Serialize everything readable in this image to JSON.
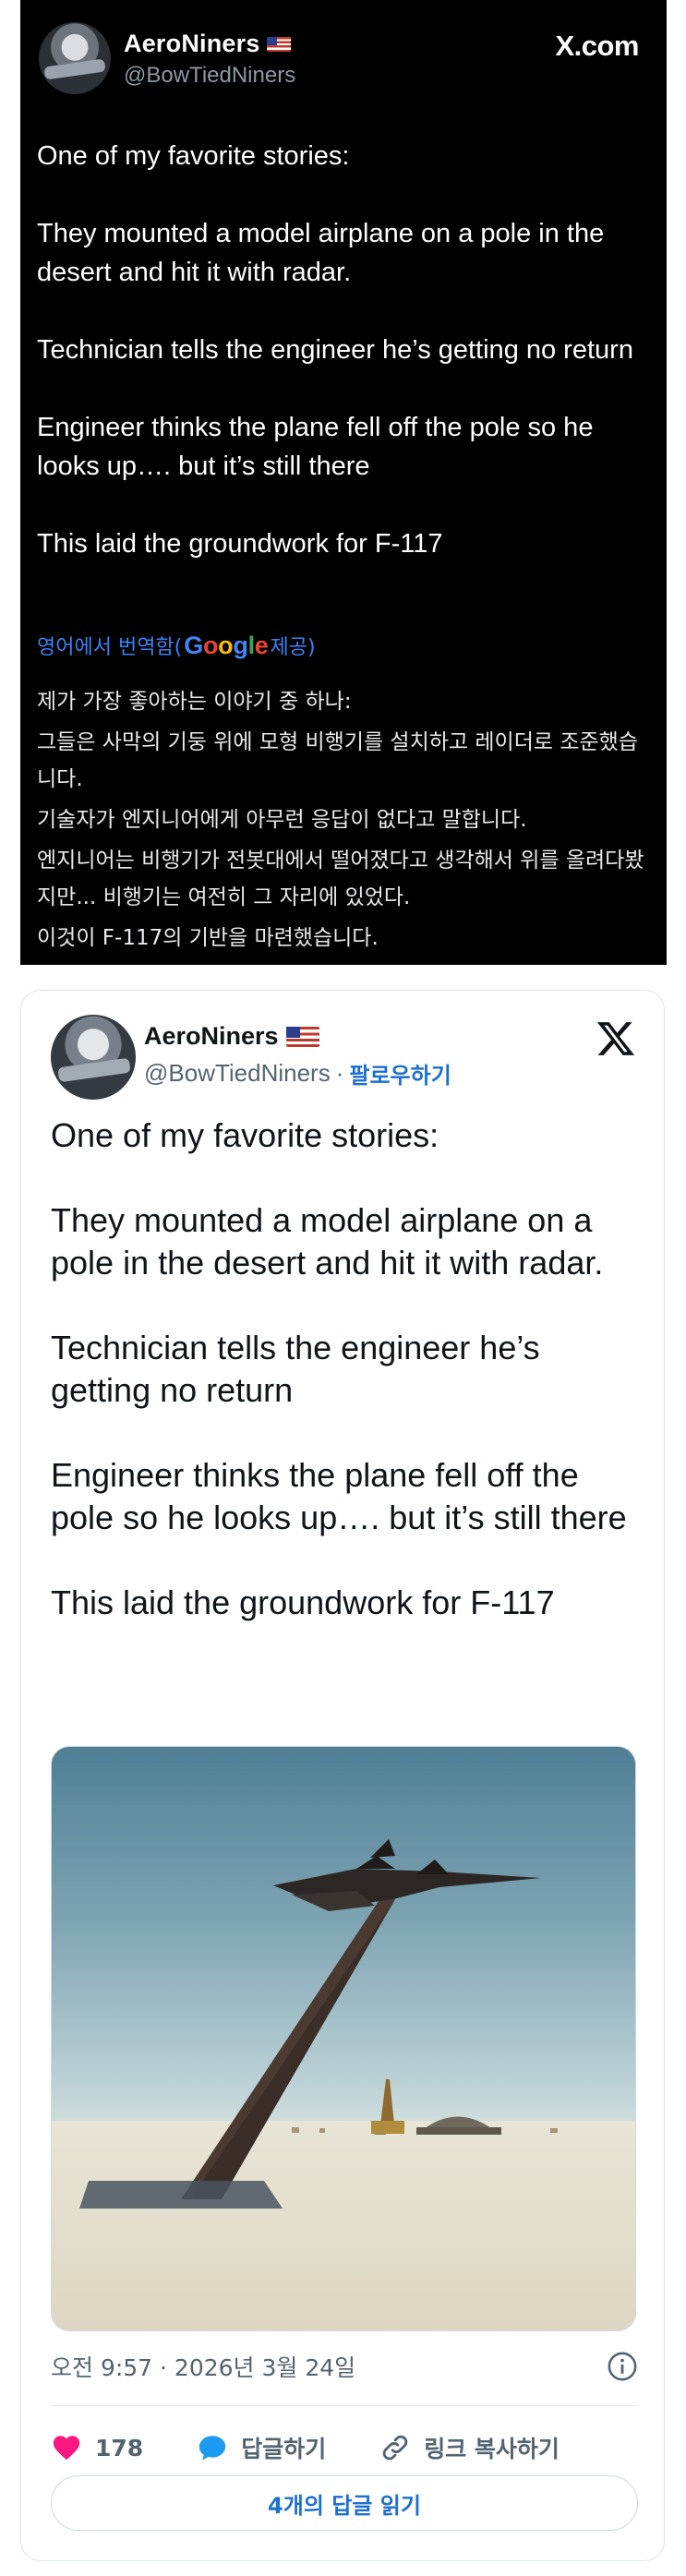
{
  "top_card": {
    "display_name": "AeroNiners",
    "handle": "@BowTiedNiners",
    "site_label": "X.com",
    "tweet_paragraphs": [
      "One of my favorite stories:",
      "They mounted a model airplane on a pole in the desert and hit it with radar.",
      "Technician tells the engineer he’s getting no return",
      "Engineer thinks the plane fell off the pole so he looks up…. but it’s still there",
      "This laid the groundwork for F-117"
    ],
    "translation_prefix": "영어에서 번역함(",
    "translation_provider": "Google",
    "translation_suffix": " 제공)",
    "translated_paragraphs": [
      "제가 가장 좋아하는 이야기 중 하나:",
      "그들은 사막의 기둥 위에 모형 비행기를 설치하고 레이더로 조준했습니다.",
      "기술자가 엔지니어에게 아무런 응답이 없다고 말합니다.",
      "엔지니어는 비행기가 전봇대에서 떨어졌다고 생각해서 위를 올려다봤지만... 비행기는 여전히 그 자리에 있었다.",
      "이것이 F-117의 기반을 마련했습니다."
    ]
  },
  "embed_card": {
    "display_name": "AeroNiners",
    "handle": "@BowTiedNiners",
    "separator": "·",
    "follow_label": "팔로우하기",
    "tweet_paragraphs": [
      "One of my favorite stories:",
      "They mounted a model airplane on a pole in the desert and hit it with radar.",
      "Technician tells the engineer he’s getting no return",
      "Engineer thinks the plane fell off the pole so he looks up…. but it’s still there",
      "This laid the groundwork for F-117"
    ],
    "timestamp": "오전 9:57 · 2026년 3월 24일",
    "actions": {
      "like_count": "178",
      "reply_label": "답글하기",
      "copy_link_label": "링크 복사하기"
    },
    "read_replies_label": "4개의 답글 읽기"
  },
  "colors": {
    "dark_bg": "#000000",
    "link_blue": "#1d6fd0",
    "like_pink": "#f91880",
    "reply_blue": "#1d9bf0",
    "muted_gray": "#536471"
  },
  "icons": [
    "flag-us-icon",
    "x-logo-icon",
    "info-icon",
    "heart-icon",
    "reply-bubble-icon",
    "link-icon"
  ]
}
